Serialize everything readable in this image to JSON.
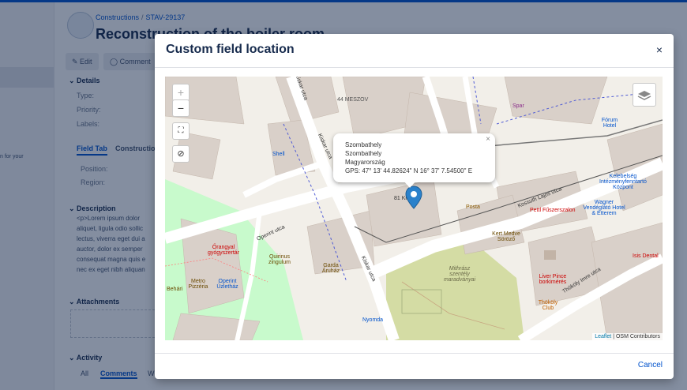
{
  "page": {
    "breadcrumb_project": "Constructions",
    "breadcrumb_sep": "/",
    "breadcrumb_issue": "STAV-29137",
    "title": "Reconstruction of the boiler room",
    "edit_label": "Edit",
    "comment_label": "Comment",
    "left_hint": "n for your",
    "details_label": "Details",
    "type_label": "Type:",
    "priority_label": "Priority:",
    "labels_label": "Labels:",
    "tab_field": "Field Tab",
    "tab_construction": "Constructio",
    "position_label": "Position:",
    "region_label": "Region:",
    "description_label": "Description",
    "description_lines": [
      "<p>Lorem ipsum dolor",
      "aliquet, ligula odio sollic",
      "lectus, viverra eget dui a",
      "auctor, dolor ex semper",
      "consequat magna quis e",
      "nec ex eget nibh aliquan"
    ],
    "attachments_label": "Attachments",
    "activity_label": "Activity",
    "activity_all": "All",
    "activity_comments": "Comments",
    "activity_w": "W"
  },
  "modal": {
    "title": "Custom field location",
    "close_glyph": "×",
    "cancel_label": "Cancel",
    "zoom_in": "+",
    "zoom_out": "−",
    "popup": {
      "line1": "Szombathely",
      "line2": "Szombathely",
      "line3": "Magyarország",
      "line4": "GPS: 47° 13' 44.82624\" N 16° 37' 7.54500\" E",
      "close": "×"
    },
    "attribution_link": "Leaflet",
    "attribution_rest": " | OSM Contributors",
    "map_labels": {
      "meszov": "44 MESZOV",
      "kiskar1": "Kiskar utca",
      "kiskar2": "Kiskar utca",
      "kiskar3": "Kiskar utca",
      "operint1": "Operint utca",
      "shell": "Shell",
      "posta": "Posta",
      "kossuth": "Kossuth Lajos utca",
      "thokoly": "Thököly Imre utca",
      "orangyal": "Őrangyal gyógyszertár",
      "quirinus": "Quirinus zingulum",
      "garda": "Garda Áruház",
      "metro": "Metro Pizzéria",
      "operint2": "Operint Üzletház",
      "behari": "Behári",
      "nyomda": "Nyomda",
      "kertmedve": "Kert Medve Söröző",
      "liver": "Liver Pince borkimérés",
      "thokoly_club": "Thököly Club",
      "wagner": "Wagner Vendéglátó Hotel & Étterem",
      "forum": "Fórum Hotel",
      "kelebi": "Kelebelség Intézményfenntartó Központ",
      "pettl": "Pettl Fűszerszalon",
      "isis": "Isis Dental",
      "spar": "Spar",
      "mithras": "Mithrász szentély maradványai",
      "kisko": "81 Kis",
      "num81": "81"
    }
  },
  "colors": {
    "accent": "#0052cc",
    "marker": "#2a81cb",
    "park": "#c8facc",
    "square": "#d4dca4"
  }
}
